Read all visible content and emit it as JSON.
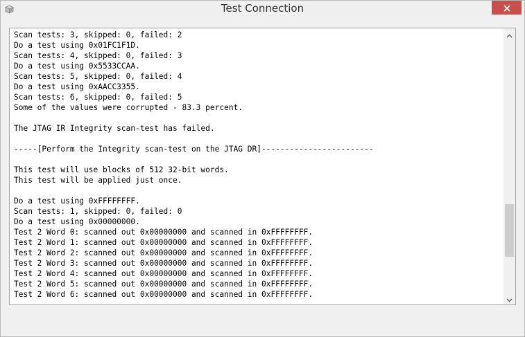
{
  "window": {
    "title": "Test Connection",
    "icon": "app-cube-icon",
    "close_icon": "close-icon"
  },
  "log": {
    "lines": [
      "Scan tests: 3, skipped: 0, failed: 2",
      "Do a test using 0x01FC1F1D.",
      "Scan tests: 4, skipped: 0, failed: 3",
      "Do a test using 0x5533CCAA.",
      "Scan tests: 5, skipped: 0, failed: 4",
      "Do a test using 0xAACC3355.",
      "Scan tests: 6, skipped: 0, failed: 5",
      "Some of the values were corrupted - 83.3 percent.",
      "",
      "The JTAG IR Integrity scan-test has failed.",
      "",
      "-----[Perform the Integrity scan-test on the JTAG DR]------------------------",
      "",
      "This test will use blocks of 512 32-bit words.",
      "This test will be applied just once.",
      "",
      "Do a test using 0xFFFFFFFF.",
      "Scan tests: 1, skipped: 0, failed: 0",
      "Do a test using 0x00000000.",
      "Test 2 Word 0: scanned out 0x00000000 and scanned in 0xFFFFFFFF.",
      "Test 2 Word 1: scanned out 0x00000000 and scanned in 0xFFFFFFFF.",
      "Test 2 Word 2: scanned out 0x00000000 and scanned in 0xFFFFFFFF.",
      "Test 2 Word 3: scanned out 0x00000000 and scanned in 0xFFFFFFFF.",
      "Test 2 Word 4: scanned out 0x00000000 and scanned in 0xFFFFFFFF.",
      "Test 2 Word 5: scanned out 0x00000000 and scanned in 0xFFFFFFFF.",
      "Test 2 Word 6: scanned out 0x00000000 and scanned in 0xFFFFFFFF."
    ],
    "scroll_position": 0.62
  }
}
